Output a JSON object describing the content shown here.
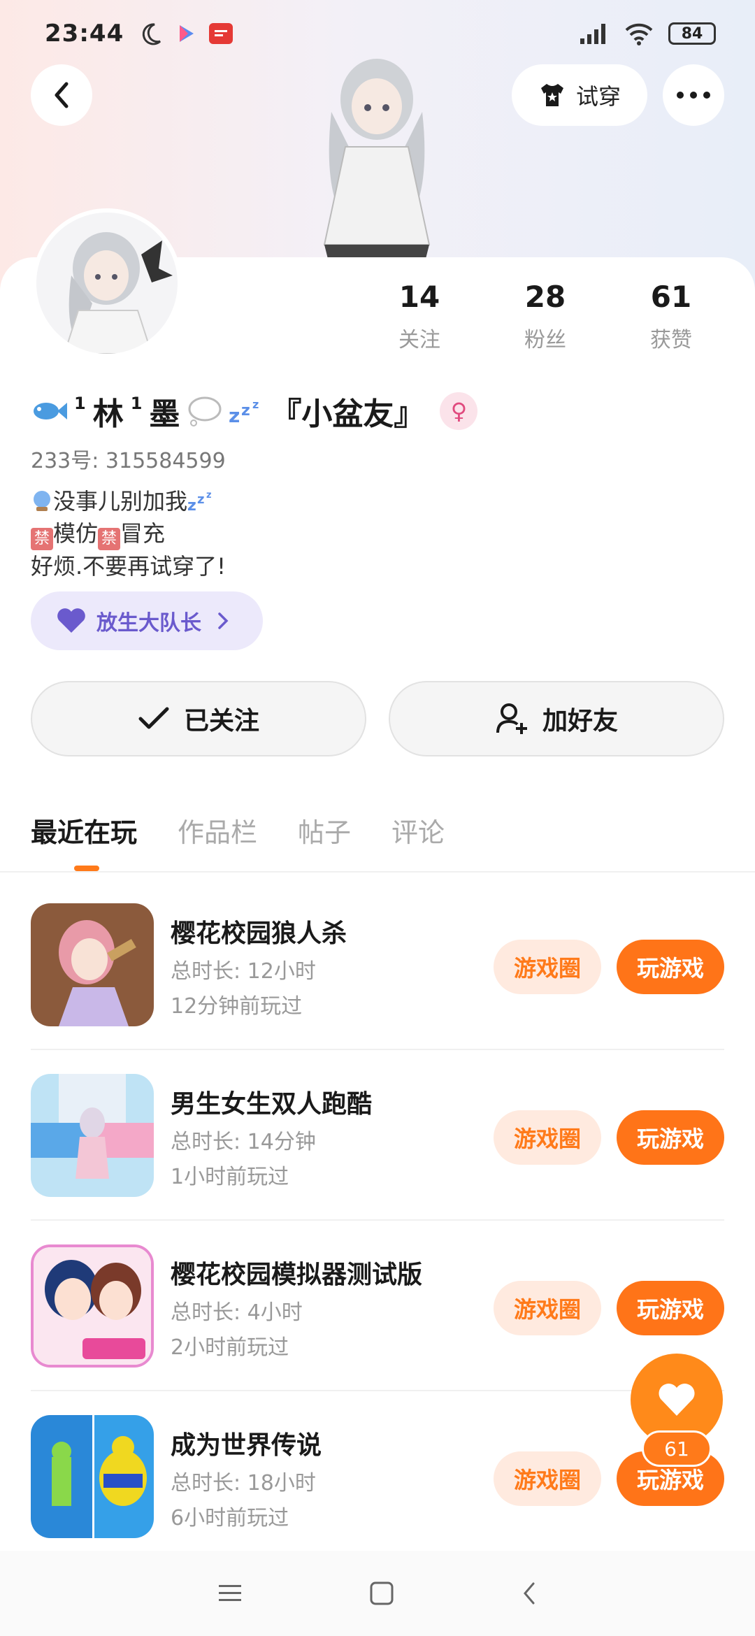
{
  "status_bar": {
    "time": "23:44",
    "battery": "84"
  },
  "header": {
    "back_icon": "chevron-left-icon",
    "tryon_label": "试穿",
    "more_icon": "more-dots-icon"
  },
  "profile": {
    "stats": [
      {
        "num": "14",
        "label": "关注"
      },
      {
        "num": "28",
        "label": "粉丝"
      },
      {
        "num": "61",
        "label": "获赞"
      }
    ],
    "name_prefix_1": "1",
    "name_char_1": "林",
    "name_prefix_2": "1",
    "name_char_2": "墨",
    "name_suffix": "『小盆友』",
    "uid": "233号: 315584599",
    "bio_line1": "没事儿别加我",
    "bio_line2_a": "禁",
    "bio_line2_b": "模仿",
    "bio_line2_c": "禁",
    "bio_line2_d": "冒充",
    "bio_line3": "好烦.不要再试穿了!",
    "badge_label": "放生大队长"
  },
  "actions": {
    "followed_label": "已关注",
    "add_friend_label": "加好友"
  },
  "tabs": [
    "最近在玩",
    "作品栏",
    "帖子",
    "评论"
  ],
  "games": [
    {
      "title": "樱花校园狼人杀",
      "duration": "总时长: 12小时",
      "last": "12分钟前玩过"
    },
    {
      "title": "男生女生双人跑酷",
      "duration": "总时长: 14分钟",
      "last": "1小时前玩过"
    },
    {
      "title": "樱花校园模拟器测试版",
      "duration": "总时长: 4小时",
      "last": "2小时前玩过"
    },
    {
      "title": "成为世界传说",
      "duration": "总时长: 18小时",
      "last": "6小时前玩过"
    }
  ],
  "game_buttons": {
    "circle_label": "游戏圈",
    "play_label": "玩游戏"
  },
  "like_fab": {
    "count": "61"
  },
  "colors": {
    "accent": "#ff7418",
    "badge_bg": "#ece9fb"
  }
}
